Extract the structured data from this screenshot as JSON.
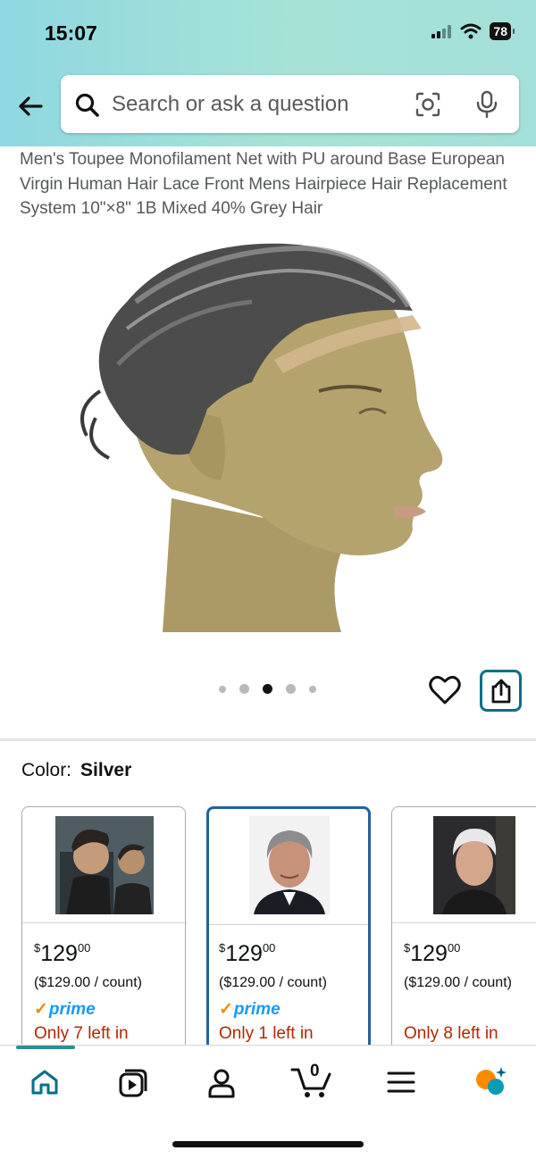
{
  "status_bar": {
    "time": "15:07",
    "battery": "78"
  },
  "search": {
    "placeholder": "Search or ask a question"
  },
  "product": {
    "title": "Men's Toupee Monofilament Net with PU around Base European Virgin Human Hair Lace Front Mens Hairpiece Hair Replacement System 10\"×8\" 1B Mixed 40% Grey Hair",
    "image_count": 5,
    "active_image_index": 2
  },
  "color": {
    "label": "Color:",
    "value": "Silver"
  },
  "swatches": [
    {
      "price_whole": "129",
      "price_fraction": "00",
      "currency": "$",
      "unit_price": "($129.00 / count)",
      "prime": "prime",
      "stock": "Only 7 left in",
      "selected": false
    },
    {
      "price_whole": "129",
      "price_fraction": "00",
      "currency": "$",
      "unit_price": "($129.00 / count)",
      "prime": "prime",
      "stock": "Only 1 left in",
      "selected": true
    },
    {
      "price_whole": "129",
      "price_fraction": "00",
      "currency": "$",
      "unit_price": "($129.00 / count)",
      "prime": "",
      "stock": "Only 8 left in",
      "selected": false
    }
  ],
  "navbar": {
    "items": [
      "home-icon",
      "video-icon",
      "account-icon",
      "cart-icon",
      "menu-icon",
      "rufus-icon"
    ],
    "cart_count": "0"
  },
  "colors": {
    "accent": "#007185",
    "selected_border": "#2162a1",
    "stock_red": "#b12704",
    "prime_blue": "#1a98ff",
    "prime_check": "#f08804"
  }
}
